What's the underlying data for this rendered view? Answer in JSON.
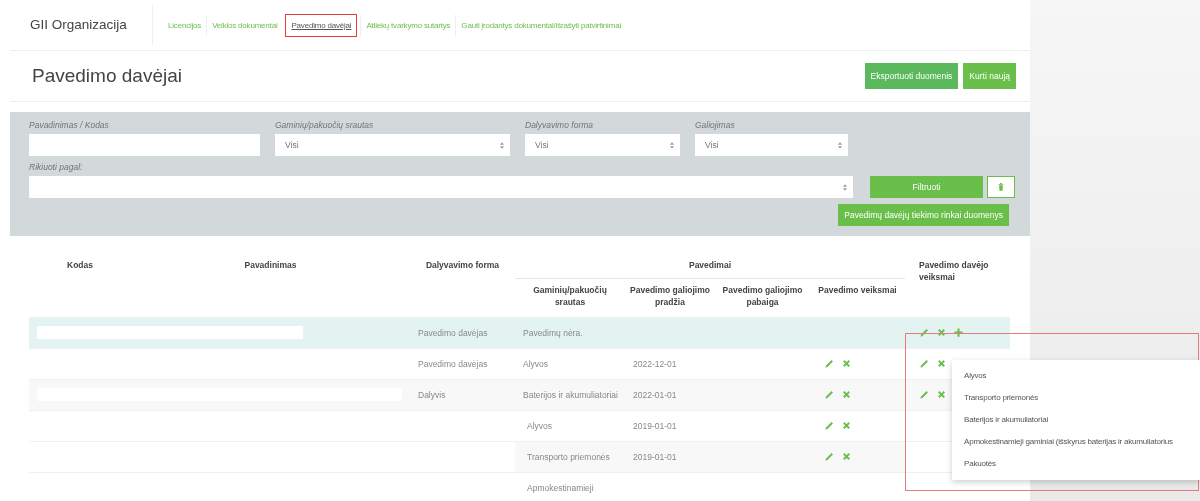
{
  "brand": "GII Organizacija",
  "nav": [
    {
      "label": "Licencijos",
      "selected": false
    },
    {
      "label": "Veiklos dokumentai",
      "selected": false
    },
    {
      "label": "Pavedimo davėjai",
      "selected": true
    },
    {
      "label": "Atliekų tvarkymo sutartys",
      "selected": false
    },
    {
      "label": "Gauti įrodantys dokumentai/išrašyti patvirtinimai",
      "selected": false
    }
  ],
  "page_title": "Pavedimo davėjai",
  "header_buttons": [
    "Eksportuoti duomenis",
    "Kurti naują"
  ],
  "filters": {
    "fields": [
      {
        "kind": "text",
        "label": "Pavadinimas / Kodas"
      },
      {
        "kind": "select",
        "label": "Gaminių/pakuočių srautas",
        "value": "Visi"
      },
      {
        "kind": "select",
        "label": "Dalyvavimo forma",
        "value": "Visi"
      },
      {
        "kind": "select",
        "label": "Galiojimas",
        "value": "Visi"
      }
    ],
    "sort_label": "Rikiuoti pagal:",
    "filter_button": "Filtruoti",
    "market_data_button": "Pavedimų davėjų tiekimo rinkai duomenys"
  },
  "table": {
    "columns": [
      "Kodas",
      "Pavadinimas",
      "Dalyvavimo forma"
    ],
    "group": {
      "label": "Pavedimai",
      "columns": [
        "Gaminių/pakuočių srautas",
        "Pavedimo galiojimo pradžia",
        "Pavedimo galiojimo pabaiga",
        "Pavedimo veiksmai"
      ]
    },
    "actions_column": "Pavedimo davėjo veiksmai",
    "rows": [
      {
        "highlighted": true,
        "redaction": {
          "kind": "short"
        },
        "form": "Pavedimo davėjas",
        "empty_text": "Pavedimų nėra.",
        "actions": [
          {
            "kind": "edit"
          },
          {
            "kind": "delete"
          },
          {
            "kind": "add"
          }
        ],
        "mandates": []
      },
      {
        "highlighted": false,
        "form": "Pavedimo davėjas",
        "actions": [
          {
            "kind": "edit"
          },
          {
            "kind": "delete"
          }
        ],
        "mandates": [
          {
            "stream": "Alyvos",
            "start": "2022-12-01",
            "actions": [
              {
                "kind": "edit"
              },
              {
                "kind": "delete"
              }
            ]
          }
        ]
      },
      {
        "highlighted": false,
        "redaction": {
          "kind": "long"
        },
        "form": "Dalyvis",
        "actions": [
          {
            "kind": "edit"
          },
          {
            "kind": "delete"
          }
        ],
        "mandates": [
          {
            "stream": "Baterijos ir akumuliatoriai",
            "start": "2022-01-01",
            "actions": [
              {
                "kind": "edit"
              },
              {
                "kind": "delete"
              }
            ]
          },
          {
            "stream": "Alyvos",
            "start": "2019-01-01",
            "actions": [
              {
                "kind": "edit"
              },
              {
                "kind": "delete"
              }
            ]
          },
          {
            "stream": "Transporto priemonės",
            "start": "2019-01-01",
            "actions": [
              {
                "kind": "edit"
              },
              {
                "kind": "delete"
              }
            ]
          },
          {
            "stream": "Apmokestinamieji"
          }
        ]
      }
    ]
  },
  "dropdown": {
    "items": [
      "Alyvos",
      "Transporto priemonės",
      "Baterijos ir akumuliatoriai",
      "Apmokestinamieji gaminiai (išskyrus baterijas ir akumuliatorius",
      "Pakuotės"
    ]
  }
}
